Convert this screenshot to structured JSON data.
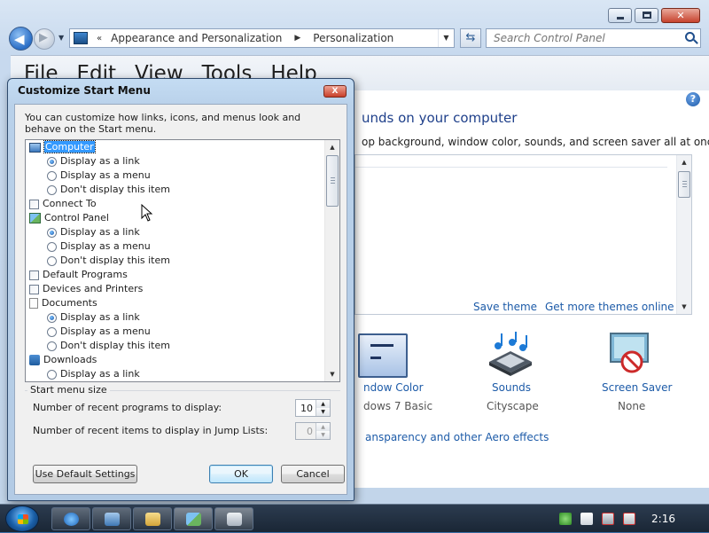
{
  "window": {
    "address": {
      "breadcrumbs": [
        "Appearance and Personalization",
        "Personalization"
      ]
    },
    "search": {
      "placeholder": "Search Control Panel"
    },
    "menu": [
      "File",
      "Edit",
      "View",
      "Tools",
      "Help"
    ],
    "heading_partial": "unds on your computer",
    "desc_partial": "op background, window color, sounds, and screen saver all at once.",
    "links": {
      "save_theme": "Save theme",
      "get_more": "Get more themes online",
      "aero": "ansparency and other Aero effects"
    },
    "tiles": [
      {
        "title": "ndow Color",
        "subtitle": "dows 7 Basic",
        "icon": "window-color-icon"
      },
      {
        "title": "Sounds",
        "subtitle": "Cityscape",
        "icon": "sounds-icon"
      },
      {
        "title": "Screen Saver",
        "subtitle": "None",
        "icon": "screen-saver-icon"
      }
    ]
  },
  "dialog": {
    "title": "Customize Start Menu",
    "close": "X",
    "description": "You can customize how links, icons, and menus look and behave on the Start menu.",
    "items": [
      {
        "label": "Computer",
        "kind": "category",
        "icon": "computer-icon",
        "selected": true
      },
      {
        "label": "Display as a link",
        "kind": "radio",
        "checked": true
      },
      {
        "label": "Display as a menu",
        "kind": "radio",
        "checked": false
      },
      {
        "label": "Don't display this item",
        "kind": "radio",
        "checked": false
      },
      {
        "label": "Connect To",
        "kind": "checkbox",
        "checked": false
      },
      {
        "label": "Control Panel",
        "kind": "category",
        "icon": "control-panel-icon"
      },
      {
        "label": "Display as a link",
        "kind": "radio",
        "checked": true
      },
      {
        "label": "Display as a menu",
        "kind": "radio",
        "checked": false
      },
      {
        "label": "Don't display this item",
        "kind": "radio",
        "checked": false
      },
      {
        "label": "Default Programs",
        "kind": "checkbox",
        "checked": false
      },
      {
        "label": "Devices and Printers",
        "kind": "checkbox",
        "checked": false
      },
      {
        "label": "Documents",
        "kind": "category",
        "icon": "documents-icon"
      },
      {
        "label": "Display as a link",
        "kind": "radio",
        "checked": true
      },
      {
        "label": "Display as a menu",
        "kind": "radio",
        "checked": false
      },
      {
        "label": "Don't display this item",
        "kind": "radio",
        "checked": false
      },
      {
        "label": "Downloads",
        "kind": "category",
        "icon": "downloads-icon"
      },
      {
        "label": "Display as a link",
        "kind": "radio",
        "checked": false
      }
    ],
    "start_menu_size": {
      "legend": "Start menu size",
      "recent_programs_label": "Number of recent programs to display:",
      "recent_programs_value": "10",
      "jump_list_label": "Number of recent items to display in Jump Lists:",
      "jump_list_value": "0"
    },
    "buttons": {
      "default_settings": "Use Default Settings",
      "ok": "OK",
      "cancel": "Cancel"
    }
  },
  "taskbar": {
    "pinned": [
      "internet-explorer-icon",
      "remote-desktop-icon",
      "windows-explorer-icon",
      "control-panel-icon",
      "start-menu-properties-icon"
    ],
    "tray": [
      "action-center-icon",
      "flag-icon",
      "network-icon",
      "volume-muted-icon"
    ],
    "clock": "2:16"
  }
}
